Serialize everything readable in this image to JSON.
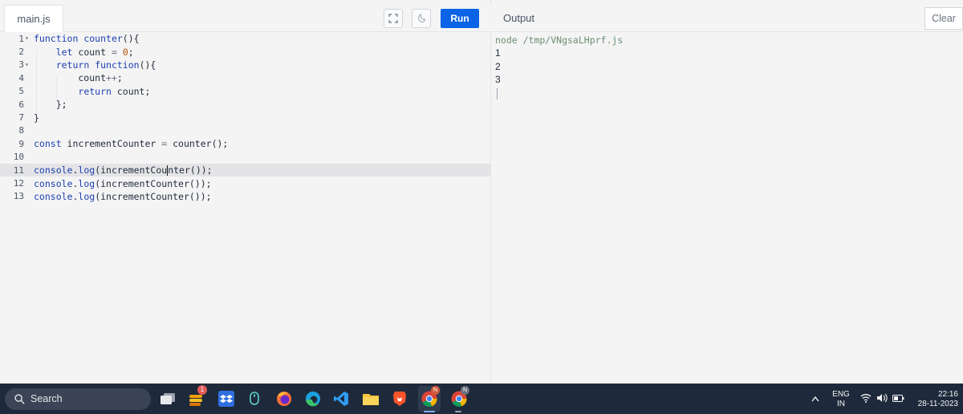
{
  "editor": {
    "tab_label": "main.js",
    "run_label": "Run",
    "lines": [
      {
        "n": "1"
      },
      {
        "n": "2"
      },
      {
        "n": "3"
      },
      {
        "n": "4"
      },
      {
        "n": "5"
      },
      {
        "n": "6"
      },
      {
        "n": "7"
      },
      {
        "n": "8"
      },
      {
        "n": "9"
      },
      {
        "n": "10"
      },
      {
        "n": "11"
      },
      {
        "n": "12"
      },
      {
        "n": "13"
      }
    ],
    "code": {
      "l1": "function counter(){",
      "l2": "    let count = 0;",
      "l3": "    return function(){",
      "l4": "        count++;",
      "l5": "        return count;",
      "l6": "    };",
      "l7": "}",
      "l9": "const incrementCounter = counter();",
      "l11": "console.log(incrementCounter());",
      "l12": "console.log(incrementCounter());",
      "l13": "console.log(incrementCounter());"
    },
    "active_line": "11"
  },
  "output": {
    "title": "Output",
    "clear_label": "Clear",
    "command": "node /tmp/VNgsaLHprf.js",
    "lines": [
      "1",
      "2",
      "3"
    ]
  },
  "taskbar": {
    "search_label": "Search",
    "language": "ENG",
    "region": "IN",
    "time": "22:16",
    "date": "28-11-2023",
    "badge_count": "1",
    "apps": [
      "task-view",
      "kubernetes-style-app",
      "dropbox",
      "teams",
      "firefox",
      "edge",
      "vscode",
      "file-explorer",
      "brave",
      "chrome",
      "chrome"
    ]
  },
  "colors": {
    "run_button": "#0b63e5",
    "taskbar": "#1e2a3b",
    "keyword": "#1e40af",
    "output_command": "#6b8f71"
  }
}
